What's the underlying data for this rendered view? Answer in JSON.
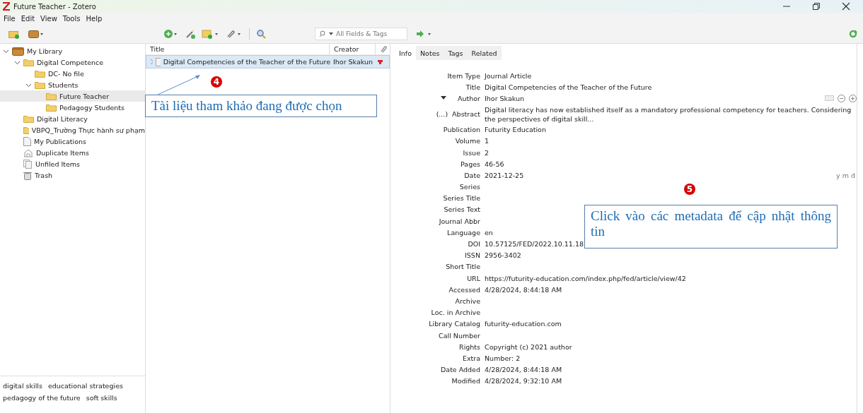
{
  "window": {
    "title": "Future Teacher - Zotero"
  },
  "menu": [
    "File",
    "Edit",
    "View",
    "Tools",
    "Help"
  ],
  "search": {
    "placeholder": "All Fields & Tags"
  },
  "sidebar": {
    "items": [
      {
        "label": "My Library",
        "kind": "library",
        "expanded": true,
        "selected": false,
        "children": [
          {
            "label": "Digital Competence",
            "kind": "folder",
            "expanded": true,
            "selected": false,
            "children": [
              {
                "label": "DC- No file",
                "kind": "folder",
                "selected": false
              },
              {
                "label": "Students",
                "kind": "folder",
                "expanded": true,
                "selected": false,
                "children": [
                  {
                    "label": "Future Teacher",
                    "kind": "folder",
                    "selected": true
                  },
                  {
                    "label": "Pedagogy Students",
                    "kind": "folder",
                    "selected": false
                  }
                ]
              }
            ]
          },
          {
            "label": "Digital Literacy",
            "kind": "folder",
            "selected": false
          },
          {
            "label": "VBPQ_Trường Thực hành sư phạm",
            "kind": "folder",
            "selected": false
          },
          {
            "label": "My Publications",
            "kind": "document",
            "selected": false
          },
          {
            "label": "Duplicate Items",
            "kind": "duplicate",
            "selected": false
          },
          {
            "label": "Unfiled Items",
            "kind": "unfiled",
            "selected": false
          },
          {
            "label": "Trash",
            "kind": "trash",
            "selected": false
          }
        ]
      }
    ]
  },
  "tags": [
    [
      "digital skills",
      "educational strategies"
    ],
    [
      "pedagogy of the future",
      "soft skills"
    ]
  ],
  "table": {
    "columns": [
      "Title",
      "Creator"
    ],
    "rows": [
      {
        "title": "Digital Competencies of the Teacher of the Future",
        "creator": "Ihor Skakun",
        "selected": true
      }
    ]
  },
  "item_pane": {
    "tabs": [
      {
        "label": "Info",
        "selected": true
      },
      {
        "label": "Notes",
        "selected": false
      },
      {
        "label": "Tags",
        "selected": false
      },
      {
        "label": "Related",
        "selected": false
      }
    ],
    "fields": [
      {
        "kind": "plain",
        "label": "Item Type",
        "value": "Journal Article"
      },
      {
        "kind": "plain",
        "label": "Title",
        "value": "Digital Competencies of the Teacher of the Future"
      },
      {
        "kind": "author",
        "label": "Author",
        "value": "Ihor Skakun"
      },
      {
        "kind": "abstract",
        "prefix": "(...)",
        "label": "Abstract",
        "value": "Digital literacy has now established itself as a mandatory professional competency for teachers. Considering the perspectives of digital skill..."
      },
      {
        "kind": "plain",
        "label": "Publication",
        "value": "Futurity Education"
      },
      {
        "kind": "plain",
        "label": "Volume",
        "value": "1"
      },
      {
        "kind": "plain",
        "label": "Issue",
        "value": "2"
      },
      {
        "kind": "plain",
        "label": "Pages",
        "value": "46-56"
      },
      {
        "kind": "date",
        "label": "Date",
        "value": "2021-12-25",
        "hint": "y m d"
      },
      {
        "kind": "plain",
        "label": "Series"
      },
      {
        "kind": "plain",
        "label": "Series Title"
      },
      {
        "kind": "plain",
        "label": "Series Text"
      },
      {
        "kind": "plain",
        "label": "Journal Abbr"
      },
      {
        "kind": "plain",
        "label": "Language",
        "value": "en"
      },
      {
        "kind": "plain",
        "label": "DOI",
        "value": "10.57125/FED/2022.10.11.18"
      },
      {
        "kind": "plain",
        "label": "ISSN",
        "value": "2956-3402"
      },
      {
        "kind": "plain",
        "label": "Short Title"
      },
      {
        "kind": "plain",
        "label": "URL",
        "value": "https://futurity-education.com/index.php/fed/article/view/42"
      },
      {
        "kind": "plain",
        "label": "Accessed",
        "value": "4/28/2024, 8:44:18 AM"
      },
      {
        "kind": "plain",
        "label": "Archive"
      },
      {
        "kind": "plain",
        "label": "Loc. in Archive"
      },
      {
        "kind": "plain",
        "label": "Library Catalog",
        "value": "futurity-education.com"
      },
      {
        "kind": "plain",
        "label": "Call Number"
      },
      {
        "kind": "plain",
        "label": "Rights",
        "value": "Copyright (c) 2021 author"
      },
      {
        "kind": "plain",
        "label": "Extra",
        "value": "Number: 2"
      },
      {
        "kind": "plain",
        "label": "Date Added",
        "value": "4/28/2024, 8:44:18 AM"
      },
      {
        "kind": "plain",
        "label": "Modified",
        "value": "4/28/2024, 9:32:10 AM"
      }
    ]
  },
  "annotations": [
    {
      "number": "4",
      "text": "Tài liệu tham khảo đang được chọn"
    },
    {
      "number": "5",
      "text": "Click vào các metadata để cập nhật thông tin"
    }
  ]
}
